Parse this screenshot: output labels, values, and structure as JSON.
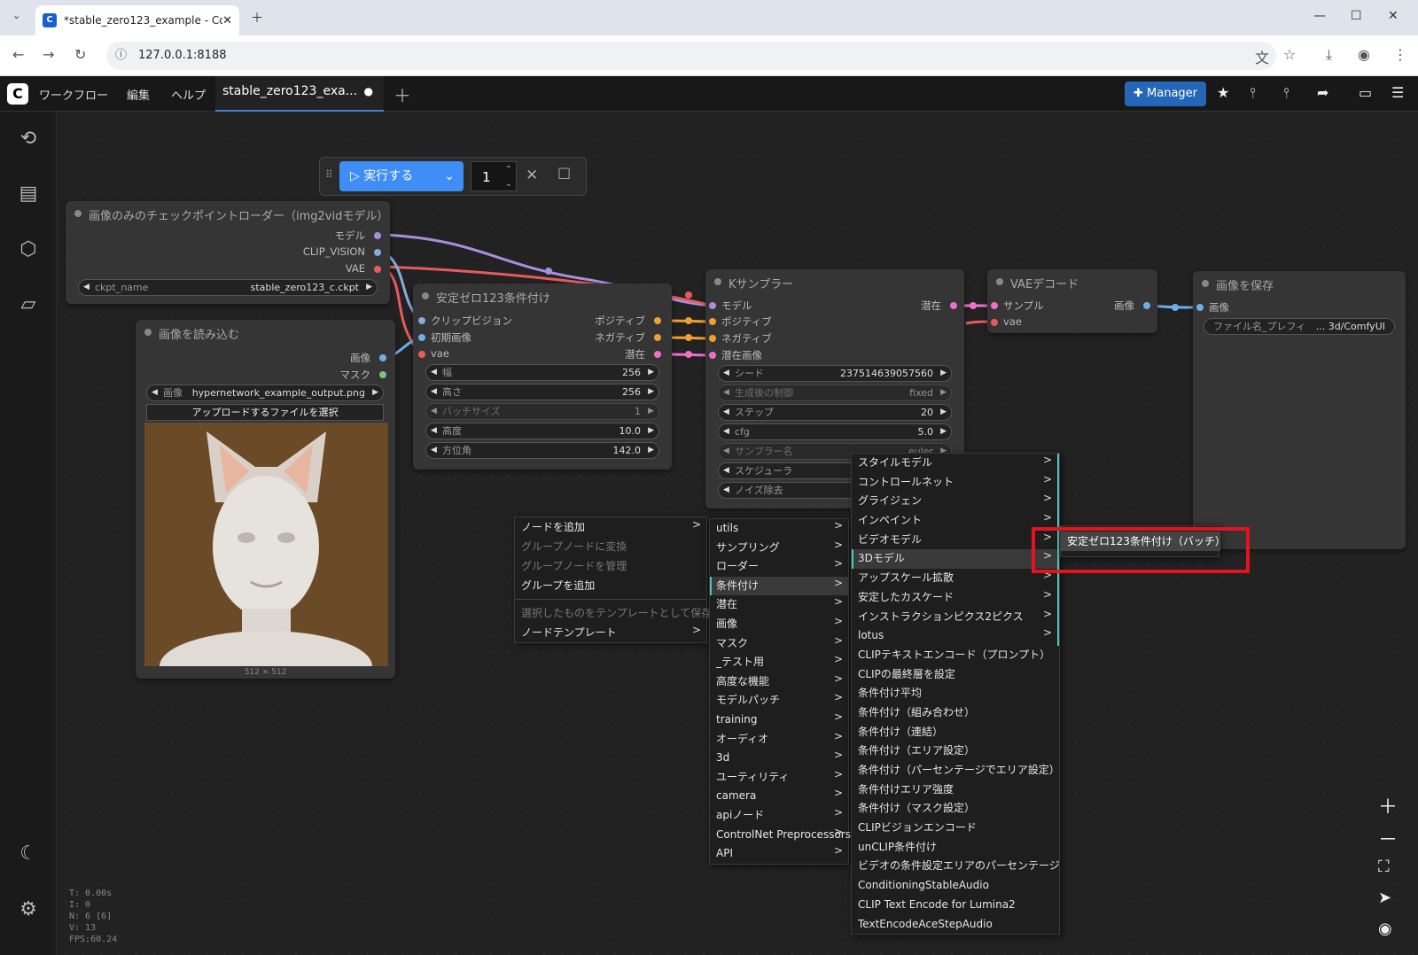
{
  "browser": {
    "tab_title": "*stable_zero123_example - Cor",
    "url": "127.0.0.1:8188"
  },
  "topbar": {
    "menu": [
      "ワークフロー",
      "編集",
      "ヘルプ"
    ],
    "workflow_tab": "stable_zero123_exa...",
    "manager_label": "Manager"
  },
  "runbar": {
    "run_label": "実行する",
    "count": "1"
  },
  "nodes": {
    "checkpoint": {
      "title": "画像のみのチェックポイントローダー（img2vidモデル）",
      "outputs": [
        "モデル",
        "CLIP_VISION",
        "VAE"
      ],
      "widget_label": "ckpt_name",
      "widget_value": "stable_zero123_c.ckpt"
    },
    "load_image": {
      "title": "画像を読み込む",
      "outputs": [
        "画像",
        "マスク"
      ],
      "widget_label": "画像",
      "widget_value": "hypernetwork_example_output.png",
      "upload_label": "アップロードするファイルを選択",
      "size_label": "512 × 512"
    },
    "zero123": {
      "title": "安定ゼロ123条件付け",
      "inputs": [
        "クリップビジョン",
        "初期画像",
        "vae"
      ],
      "outputs": [
        "ポジティブ",
        "ネガティブ",
        "潜在"
      ],
      "widgets": [
        {
          "label": "幅",
          "value": "256"
        },
        {
          "label": "高さ",
          "value": "256"
        },
        {
          "label": "バッチサイズ",
          "value": "1"
        },
        {
          "label": "高度",
          "value": "10.0"
        },
        {
          "label": "方位角",
          "value": "142.0"
        }
      ]
    },
    "ksampler": {
      "title": "Kサンプラー",
      "inputs": [
        "モデル",
        "ポジティブ",
        "ネガティブ",
        "潜在画像"
      ],
      "output": "潜在",
      "widgets": [
        {
          "label": "シード",
          "value": "237514639057560"
        },
        {
          "label": "生成後の制御",
          "value": "fixed"
        },
        {
          "label": "ステップ",
          "value": "20"
        },
        {
          "label": "cfg",
          "value": "5.0"
        },
        {
          "label": "サンプラー名",
          "value": "euler"
        },
        {
          "label": "スケジューラ",
          "value": ""
        },
        {
          "label": "ノイズ除去",
          "value": ""
        }
      ]
    },
    "vae_decode": {
      "title": "VAEデコード",
      "inputs": [
        "サンプル",
        "vae"
      ],
      "output": "画像"
    },
    "save_image": {
      "title": "画像を保存",
      "input": "画像",
      "widget_label": "ファイル名_プレフィ",
      "widget_value": "... 3d/ComfyUI"
    }
  },
  "menu1": [
    {
      "label": "ノードを追加",
      "state": "sub"
    },
    {
      "label": "グループノードに変換",
      "state": "dis"
    },
    {
      "label": "グループノードを管理",
      "state": "dis"
    },
    {
      "label": "グループを追加",
      "state": ""
    },
    {
      "label": "選択したものをテンプレートとして保存",
      "state": "dis"
    },
    {
      "label": "ノードテンプレート",
      "state": "sub"
    }
  ],
  "menu2": [
    "utils",
    "サンプリング",
    "ローダー",
    "条件付け",
    "潜在",
    "画像",
    "マスク",
    "_テスト用",
    "高度な機能",
    "モデルパッチ",
    "training",
    "オーディオ",
    "3d",
    "ユーティリティ",
    "camera",
    "apiノード",
    "ControlNet Preprocessors",
    "API"
  ],
  "menu3": [
    {
      "label": "スタイルモデル",
      "sub": true
    },
    {
      "label": "コントロールネット",
      "sub": true
    },
    {
      "label": "グライジェン",
      "sub": true
    },
    {
      "label": "インペイント",
      "sub": true
    },
    {
      "label": "ビデオモデル",
      "sub": true
    },
    {
      "label": "3Dモデル",
      "sub": true
    },
    {
      "label": "アップスケール拡散",
      "sub": true
    },
    {
      "label": "安定したカスケード",
      "sub": true
    },
    {
      "label": "インストラクションピクス2ピクス",
      "sub": true
    },
    {
      "label": "lotus",
      "sub": true
    },
    {
      "label": "CLIPテキストエンコード（プロンプト）",
      "sub": false
    },
    {
      "label": "CLIPの最終層を設定",
      "sub": false
    },
    {
      "label": "条件付け平均",
      "sub": false
    },
    {
      "label": "条件付け（組み合わせ）",
      "sub": false
    },
    {
      "label": "条件付け（連結）",
      "sub": false
    },
    {
      "label": "条件付け（エリア設定）",
      "sub": false
    },
    {
      "label": "条件付け（パーセンテージでエリア設定）",
      "sub": false
    },
    {
      "label": "条件付けエリア強度",
      "sub": false
    },
    {
      "label": "条件付け（マスク設定）",
      "sub": false
    },
    {
      "label": "CLIPビジョンエンコード",
      "sub": false
    },
    {
      "label": "unCLIP条件付け",
      "sub": false
    },
    {
      "label": "ビデオの条件設定エリアのパーセンテージ",
      "sub": false
    },
    {
      "label": "ConditioningStableAudio",
      "sub": false
    },
    {
      "label": "CLIP Text Encode for Lumina2",
      "sub": false
    },
    {
      "label": "TextEncodeAceStepAudio",
      "sub": false
    }
  ],
  "menu4": [
    "安定ゼロ123条件付け（バッチ）"
  ],
  "stats": [
    "T: 0.00s",
    "I: 0",
    "N: 6 [6]",
    "V: 13",
    "FPS:60.24"
  ],
  "colors": {
    "accent": "#3f8ef5",
    "highlight": "#e4141f",
    "menu_sel": "#4cc4c4"
  }
}
